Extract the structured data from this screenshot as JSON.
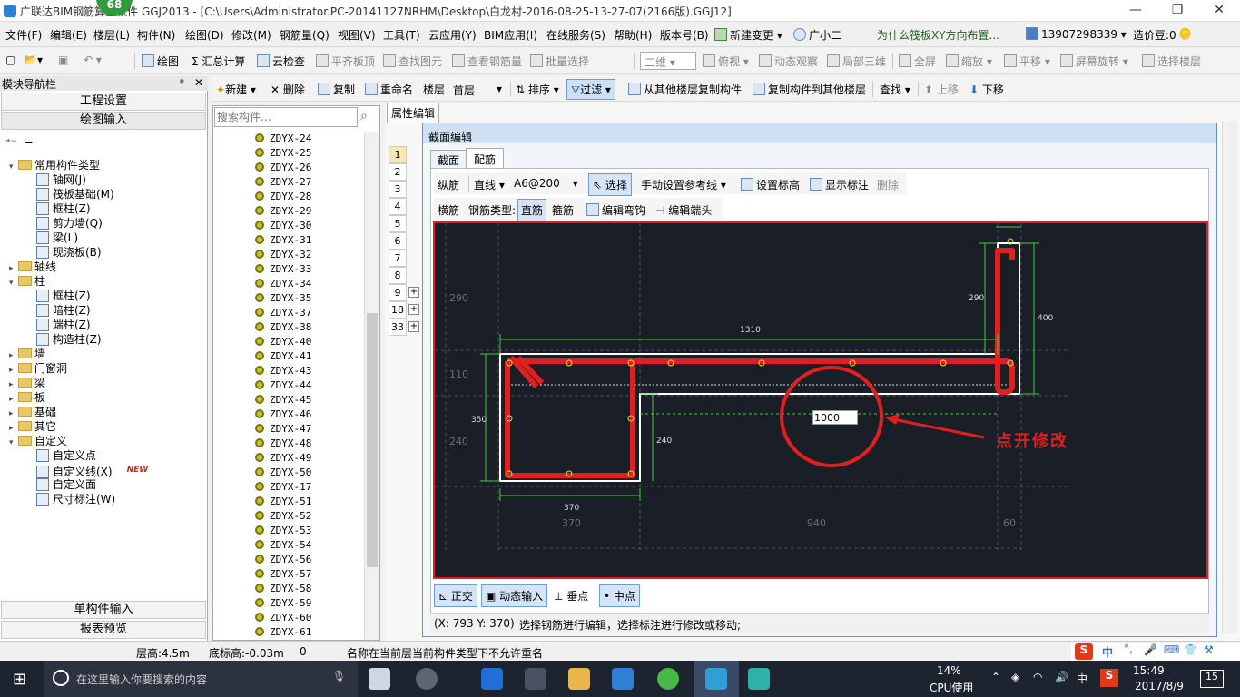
{
  "titlebar": {
    "badge": "68",
    "title": "广联达BIM钢筋算量软件 GGJ2013 - [C:\\Users\\Administrator.PC-20141127NRHM\\Desktop\\白龙村-2016-08-25-13-27-07(2166版).GGJ12]",
    "minimize": "—",
    "restore": "❐",
    "close": "✕"
  },
  "menu": {
    "items": [
      "文件(F)",
      "编辑(E)",
      "楼层(L)",
      "构件(N)",
      "绘图(D)",
      "修改(M)",
      "钢筋量(Q)",
      "视图(V)",
      "工具(T)",
      "云应用(Y)",
      "BIM应用(I)",
      "在线服务(S)",
      "帮助(H)",
      "版本号(B)"
    ],
    "new_change": "新建变更",
    "assistant": "广小二",
    "hint": "为什么筏板XY方向布置...",
    "phone": "13907298339",
    "price_bean": "造价豆:0"
  },
  "toolbar1": {
    "draw": "绘图",
    "sum": "汇总计算",
    "cloud_check": "云检查",
    "flat_slab": "平齐板顶",
    "find_elem": "查找图元",
    "view_rebar": "查看钢筋量",
    "batch_select": "批量选择",
    "view_mode": "二维",
    "top_view": "俯视",
    "dynamic": "动态观察",
    "local3d": "局部三维",
    "fullscreen": "全屏",
    "zoom": "缩放",
    "pan": "平移",
    "rotate": "屏幕旋转",
    "select_floor": "选择楼层"
  },
  "toolbar2": {
    "new": "新建",
    "delete": "删除",
    "copy": "复制",
    "rename": "重命名",
    "floor_label": "楼层",
    "floor_value": "首层",
    "sort": "排序",
    "filter": "过滤",
    "copy_from": "从其他楼层复制构件",
    "copy_to": "复制构件到其他楼层",
    "find": "查找",
    "move_up": "上移",
    "move_down": "下移"
  },
  "nav": {
    "header": "模块导航栏",
    "pin": "ᵖ",
    "close": "✕",
    "project_settings": "工程设置",
    "draw_input": "绘图输入",
    "single_input": "单构件输入",
    "report_preview": "报表预览",
    "tree": [
      {
        "label": "常用构件类型",
        "level": 0,
        "exp": "▾",
        "type": "folder"
      },
      {
        "label": "轴网(J)",
        "level": 1,
        "type": "leaf"
      },
      {
        "label": "筏板基础(M)",
        "level": 1,
        "type": "leaf"
      },
      {
        "label": "框柱(Z)",
        "level": 1,
        "type": "leaf"
      },
      {
        "label": "剪力墙(Q)",
        "level": 1,
        "type": "leaf"
      },
      {
        "label": "梁(L)",
        "level": 1,
        "type": "leaf"
      },
      {
        "label": "现浇板(B)",
        "level": 1,
        "type": "leaf"
      },
      {
        "label": "轴线",
        "level": 0,
        "exp": "▸",
        "type": "folder"
      },
      {
        "label": "柱",
        "level": 0,
        "exp": "▾",
        "type": "folder"
      },
      {
        "label": "框柱(Z)",
        "level": 1,
        "type": "leaf"
      },
      {
        "label": "暗柱(Z)",
        "level": 1,
        "type": "leaf"
      },
      {
        "label": "端柱(Z)",
        "level": 1,
        "type": "leaf"
      },
      {
        "label": "构造柱(Z)",
        "level": 1,
        "type": "leaf"
      },
      {
        "label": "墙",
        "level": 0,
        "exp": "▸",
        "type": "folder"
      },
      {
        "label": "门窗洞",
        "level": 0,
        "exp": "▸",
        "type": "folder"
      },
      {
        "label": "梁",
        "level": 0,
        "exp": "▸",
        "type": "folder"
      },
      {
        "label": "板",
        "level": 0,
        "exp": "▸",
        "type": "folder"
      },
      {
        "label": "基础",
        "level": 0,
        "exp": "▸",
        "type": "folder"
      },
      {
        "label": "其它",
        "level": 0,
        "exp": "▸",
        "type": "folder"
      },
      {
        "label": "自定义",
        "level": 0,
        "exp": "▾",
        "type": "folder"
      },
      {
        "label": "自定义点",
        "level": 1,
        "type": "leaf"
      },
      {
        "label": "自定义线(X)",
        "level": 1,
        "type": "leaf",
        "badge": "NEW"
      },
      {
        "label": "自定义面",
        "level": 1,
        "type": "leaf"
      },
      {
        "label": "尺寸标注(W)",
        "level": 1,
        "type": "leaf"
      }
    ]
  },
  "list": {
    "search_placeholder": "搜索构件...",
    "items": [
      "ZDYX-24",
      "ZDYX-25",
      "ZDYX-26",
      "ZDYX-27",
      "ZDYX-28",
      "ZDYX-29",
      "ZDYX-30",
      "ZDYX-31",
      "ZDYX-32",
      "ZDYX-33",
      "ZDYX-34",
      "ZDYX-35",
      "ZDYX-37",
      "ZDYX-38",
      "ZDYX-40",
      "ZDYX-41",
      "ZDYX-43",
      "ZDYX-44",
      "ZDYX-45",
      "ZDYX-46",
      "ZDYX-47",
      "ZDYX-48",
      "ZDYX-49",
      "ZDYX-50",
      "ZDYX-17",
      "ZDYX-51",
      "ZDYX-52",
      "ZDYX-53",
      "ZDYX-54",
      "ZDYX-56",
      "ZDYX-57",
      "ZDYX-58",
      "ZDYX-59",
      "ZDYX-60",
      "ZDYX-61"
    ]
  },
  "props": {
    "tab": "属性编辑",
    "rows": [
      "1",
      "2",
      "3",
      "4",
      "5",
      "6",
      "7",
      "8",
      "9",
      "18",
      "33"
    ]
  },
  "dialog": {
    "title": "截面编辑",
    "tab_section": "截面",
    "tab_rebar": "配筋",
    "row1": {
      "longitudinal": "纵筋",
      "line": "直线",
      "spec": "A6@200",
      "select": "选择",
      "manual_ref": "手动设置参考线",
      "set_elev": "设置标高",
      "show_dims": "显示标注",
      "delete": "删除"
    },
    "row2": {
      "transverse": "横筋",
      "rebar_type": "钢筋类型:",
      "straight": "直筋",
      "stirrup": "箍筋",
      "edit_hook": "编辑弯钩",
      "edit_end": "编辑端头"
    },
    "bottom": {
      "ortho": "正交",
      "dyn_input": "动态输入",
      "perp": "垂点",
      "mid": "中点"
    },
    "coords": "(X: 793 Y: 370)",
    "status": "选择钢筋进行编辑，选择标注进行修改或移动;"
  },
  "drawing": {
    "dims": {
      "d1310": "1310",
      "d290a": "290",
      "d400": "400",
      "d350": "350",
      "d240": "240",
      "d370": "370",
      "input_value": "1000"
    },
    "gray": {
      "g290": "290",
      "g110": "110",
      "g240": "240",
      "g370": "370",
      "g940": "940",
      "g60": "60"
    },
    "annotation": "点开修改",
    "rebar_color": "#e02020"
  },
  "status": {
    "floor_height": "层高:4.5m",
    "bottom_elev": "底标高:-0.03m",
    "zero": "0",
    "message": "名称在当前层当前构件类型下不允许重名"
  },
  "taskbar": {
    "search_placeholder": "在这里输入你要搜索的内容",
    "cpu_percent": "14%",
    "cpu_label": "CPU使用",
    "ime": "中",
    "time": "15:49",
    "date": "2017/8/9",
    "notif": "15"
  }
}
